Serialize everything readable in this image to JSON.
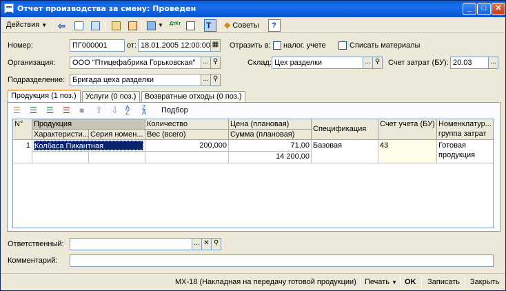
{
  "window": {
    "title": "Отчет производства за смену: Проведен"
  },
  "toolbar": {
    "actions_label": "Действия",
    "tips_label": "Советы",
    "icons": [
      "back-icon",
      "new-icon",
      "copy-icon",
      "post-icon",
      "unpost-icon",
      "move-icon",
      "dtkt-icon",
      "structure-icon",
      "text-icon",
      "tips-icon",
      "help-icon"
    ],
    "dtkt_text": "ДтКт",
    "help_text": "?"
  },
  "header": {
    "number_label": "Номер:",
    "number_value": "ПГ000001",
    "date_label": "от:",
    "date_value": "18.01.2005 12:00:00",
    "reflect_label": "Отразить в:",
    "tax_label": "налог. учете",
    "write_off_label": "Списать материалы",
    "org_label": "Организация:",
    "org_value": "ООО \"Птицефабрика Горьковская\"",
    "warehouse_label": "Склад:",
    "warehouse_value": "Цех разделки",
    "cost_account_label": "Счет затрат (БУ):",
    "cost_account_value": "20.03",
    "division_label": "Подразделение:",
    "division_value": "Бригада цеха разделки"
  },
  "tabs": [
    {
      "label": "Продукция (1 поз.)"
    },
    {
      "label": "Услуги (0 поз.)"
    },
    {
      "label": "Возвратные отходы (0 поз.)"
    }
  ],
  "table_toolbar": {
    "pick_label": "Подбор"
  },
  "table": {
    "headers": {
      "num": "N°",
      "product": "Продукция",
      "characteristic": "Характеристи...",
      "series": "Серия номен...",
      "quantity": "Количество",
      "weight": "Вес (всего)",
      "price": "Цена (плановая)",
      "sum": "Сумма (плановая)",
      "spec": "Спецификация",
      "account": "Счет учета (БУ)",
      "nomen_group": "Номенклатур... группа затрат"
    },
    "rows": [
      {
        "num": "1",
        "product": "Колбаса Пикантная",
        "characteristic": "",
        "series": "",
        "quantity": "200,000",
        "weight": "",
        "price": "71,00",
        "sum": "14 200,00",
        "spec": "Базовая",
        "account": "43",
        "nomen_group": "Готовая продукция"
      }
    ]
  },
  "footer": {
    "responsible_label": "Ответственный:",
    "responsible_value": "",
    "comment_label": "Комментарий:",
    "comment_value": ""
  },
  "statusbar": {
    "form_label": "МХ-18 (Накладная на передачу готовой продукции)",
    "print_label": "Печать",
    "ok_label": "OK",
    "save_label": "Записать",
    "close_label": "Закрыть"
  }
}
